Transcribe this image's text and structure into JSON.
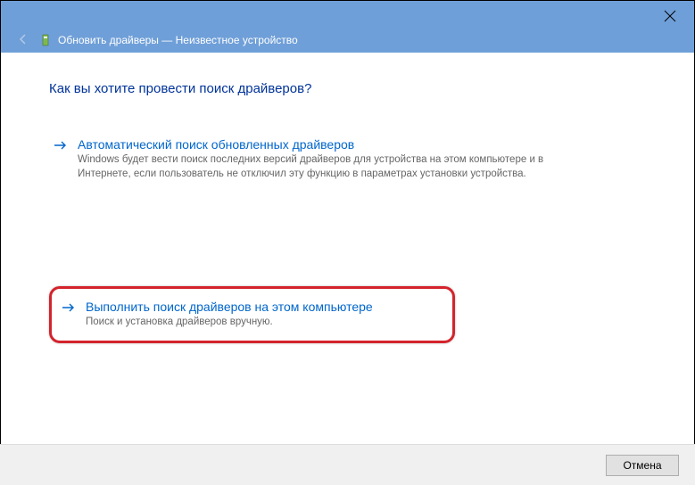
{
  "titlebar": {
    "back_disabled": true,
    "title": "Обновить драйверы — Неизвестное устройство"
  },
  "heading": "Как вы хотите провести поиск драйверов?",
  "options": [
    {
      "title": "Автоматический поиск обновленных драйверов",
      "desc": "Windows будет вести поиск последних версий драйверов для устройства на этом компьютере и в Интернете, если пользователь не отключил эту функцию в параметрах установки устройства."
    },
    {
      "title": "Выполнить поиск драйверов на этом компьютере",
      "desc": "Поиск и установка драйверов вручную."
    }
  ],
  "footer": {
    "cancel": "Отмена"
  }
}
